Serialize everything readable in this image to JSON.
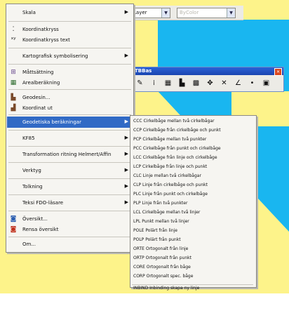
{
  "colors": {
    "canvas": "#fdf38a",
    "cyan": "#19b6f0",
    "highlight": "#316ac5",
    "titlebar": "#2b61d6"
  },
  "properties_bar": {
    "layer_combo": "Layer",
    "color_combo": "ByColor"
  },
  "tbbas": {
    "title": "TBBas",
    "close": "✕",
    "tools": [
      "pencil-icon",
      "coordinate-icon",
      "measure-icon",
      "building-icon",
      "grid-icon",
      "pan-icon",
      "cross-icon",
      "angle-icon",
      "point-icon",
      "image-icon"
    ]
  },
  "menu": {
    "items": [
      {
        "label": "Skala",
        "arrow": "▶",
        "icon": ""
      },
      {
        "label": "Koordinatkryss",
        "icon": "cross-points-icon"
      },
      {
        "label": "Koordinatkryss text",
        "icon": "xy-text-icon"
      },
      {
        "label": "Kartografisk symbolisering",
        "arrow": "▶",
        "icon": ""
      },
      {
        "label": "Måttsättning",
        "icon": "dimension-icon"
      },
      {
        "label": "Arealberäkning",
        "icon": "area-icon"
      },
      {
        "label": "Geodesin...",
        "icon": "geodesy-icon"
      },
      {
        "label": "Koordinat ut",
        "icon": "coordinate-out-icon"
      },
      {
        "label": "Geodetiska beräkningar",
        "arrow": "▶",
        "icon": ""
      },
      {
        "label": "KF85",
        "arrow": "▶",
        "icon": ""
      },
      {
        "label": "Transformation ritning Helmert/Affin",
        "arrow": "▶",
        "icon": ""
      },
      {
        "label": "Verktyg",
        "arrow": "▶",
        "icon": ""
      },
      {
        "label": "Tolkning",
        "arrow": "▶",
        "icon": ""
      },
      {
        "label": "Teksi FDO-läsare",
        "arrow": "▶",
        "icon": ""
      },
      {
        "label": "Översikt...",
        "icon": "overview-icon"
      },
      {
        "label": "Rensa översikt",
        "icon": "clear-overview-icon"
      },
      {
        "label": "Om...",
        "icon": ""
      }
    ]
  },
  "submenu": {
    "items": [
      "CCC  Cirkelbåge mellan två cirkelbågar",
      "CCP  Cirkelbåge från cirkelbåge och punkt",
      "PCP  Cirkelbåge mellan två punkter",
      "PCC  Cirkelbåge från punkt och cirkelbåge",
      "LCC  Cirkelbåge från linje och cirkelbåge",
      "LCP  Cirkelbåge från linje och punkt",
      "CLC  Linje mellan två cirkelbågar",
      "CLP  Linje från cirkelbåge och punkt",
      "PLC  Linje från punkt och cirkelbåge",
      "PLP  Linje från två punkter",
      "LCL  Cirkelbåge mellan två linjer",
      "LPL  Punkt mellan två linjer",
      "POLE  Polärt från linje",
      "POLP  Polärt från punkt",
      "ORTE  Ortogonalt från linje",
      "ORTP  Ortogonalt från punkt",
      "CORE  Ortogonalt från båge",
      "CORP  Ortogonalt spec. båge",
      "INBIND  Inbinding skapa ny linje"
    ]
  }
}
